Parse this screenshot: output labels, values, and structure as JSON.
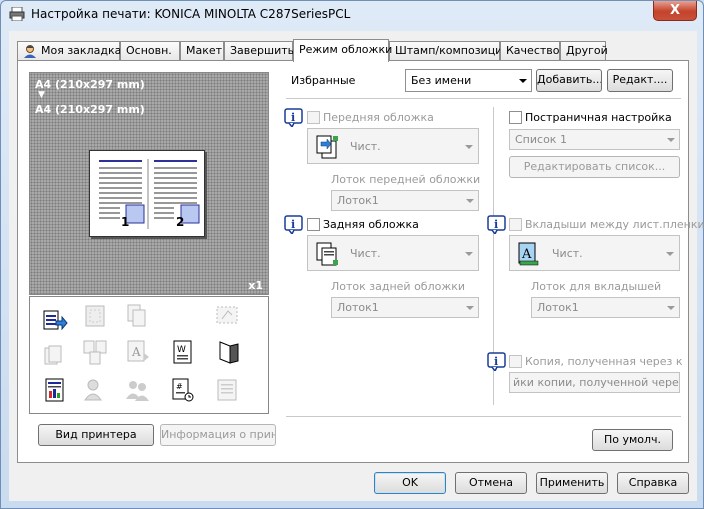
{
  "window": {
    "title": "Настройка печати: KONICA MINOLTA C287SeriesPCL",
    "close_label": "X"
  },
  "tabs": [
    {
      "label": "Моя закладка"
    },
    {
      "label": "Основн."
    },
    {
      "label": "Макет"
    },
    {
      "label": "Завершить"
    },
    {
      "label": "Режим обложки"
    },
    {
      "label": "Штамп/композиция"
    },
    {
      "label": "Качество"
    },
    {
      "label": "Другой"
    }
  ],
  "preview": {
    "paper_line1": "A4 (210x297 mm)",
    "arrow": "▼",
    "paper_line2": "A4 (210x297 mm)",
    "copies": "x1",
    "page1": "1",
    "page2": "2"
  },
  "left_buttons": {
    "printer_view": "Вид принтера",
    "printer_info": "Информация о принт."
  },
  "favorites": {
    "label": "Избранные",
    "value": "Без имени",
    "add": "Добавить...",
    "edit": "Редакт...."
  },
  "front_cover": {
    "checkbox_label": "Передняя обложка",
    "paper_value": "Чист.",
    "tray_label": "Лоток передней обложки",
    "tray_value": "Лоток1"
  },
  "back_cover": {
    "checkbox_label": "Задняя обложка",
    "paper_value": "Чист.",
    "tray_label": "Лоток задней обложки",
    "tray_value": "Лоток1"
  },
  "page_setting": {
    "checkbox_label": "Постраничная настройка",
    "list_value": "Список 1",
    "edit_list": "Редактировать список..."
  },
  "interleave": {
    "checkbox_label": "Вкладыши между лист.пленки",
    "paper_value": "Чист.",
    "tray_label": "Лоток для вкладышей",
    "tray_value": "Лоток1"
  },
  "carbon": {
    "checkbox_label": "Копия, полученная через копир",
    "field_value": "йки копии, полученной через копи"
  },
  "defaults_button": "По умолч.",
  "bottom_buttons": {
    "ok": "OK",
    "cancel": "Отмена",
    "apply": "Применить",
    "help": "Справка"
  }
}
